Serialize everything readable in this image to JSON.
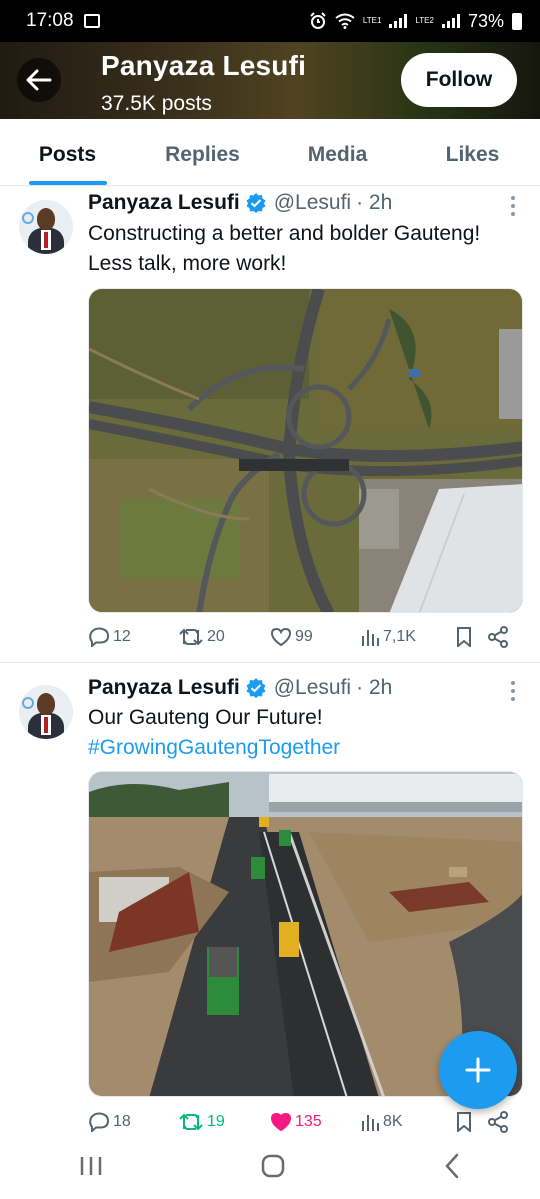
{
  "status_bar": {
    "time": "17:08",
    "battery": "73%",
    "sim1": "LTE1",
    "sim2": "LTE2"
  },
  "header": {
    "title": "Panyaza Lesufi",
    "subtitle": "37.5K posts",
    "follow_label": "Follow"
  },
  "tabs": [
    {
      "label": "Posts",
      "active": true
    },
    {
      "label": "Replies",
      "active": false
    },
    {
      "label": "Media",
      "active": false
    },
    {
      "label": "Likes",
      "active": false
    }
  ],
  "posts": [
    {
      "author": "Panyaza Lesufi",
      "handle": "@Lesufi",
      "time": "· 2h",
      "text": "Constructing a better and bolder Gauteng! Less talk, more work!",
      "hashtag": "",
      "replies": "12",
      "reposts": "20",
      "likes": "99",
      "views": "7,1K",
      "reposted": false,
      "liked": false
    },
    {
      "author": "Panyaza Lesufi",
      "handle": "@Lesufi",
      "time": "· 2h",
      "text": "Our Gauteng Our Future!",
      "hashtag": "#GrowingGautengTogether",
      "replies": "18",
      "reposts": "19",
      "likes": "135",
      "views": "8K",
      "reposted": true,
      "liked": true
    }
  ],
  "colors": {
    "accent": "#1d9bf0",
    "repost_active": "#00ba7c",
    "like_active": "#f91880",
    "muted": "#536471"
  }
}
